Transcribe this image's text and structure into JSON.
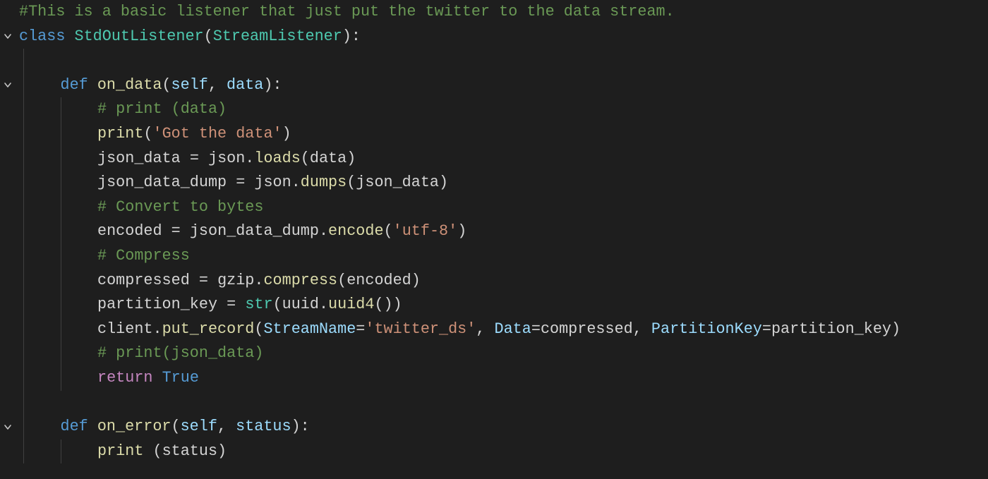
{
  "folds": [
    {
      "line": 2,
      "iconName": "chevron-down-icon"
    },
    {
      "line": 4,
      "iconName": "chevron-down-icon"
    },
    {
      "line": 18,
      "iconName": "chevron-down-icon"
    }
  ],
  "code": {
    "lines": [
      {
        "indent": 0,
        "tokens": [
          {
            "text": "#This is a basic listener that just put the twitter to the data stream.",
            "cls": "c-comment"
          }
        ]
      },
      {
        "indent": 0,
        "tokens": [
          {
            "text": "class",
            "cls": "c-keyword"
          },
          {
            "text": " ",
            "cls": "c-default"
          },
          {
            "text": "StdOutListener",
            "cls": "c-class"
          },
          {
            "text": "(",
            "cls": "c-default"
          },
          {
            "text": "StreamListener",
            "cls": "c-class"
          },
          {
            "text": "):",
            "cls": "c-default"
          }
        ]
      },
      {
        "indent": 1,
        "tokens": []
      },
      {
        "indent": 1,
        "tokens": [
          {
            "text": "def",
            "cls": "c-keyword"
          },
          {
            "text": " ",
            "cls": "c-default"
          },
          {
            "text": "on_data",
            "cls": "c-func"
          },
          {
            "text": "(",
            "cls": "c-default"
          },
          {
            "text": "self",
            "cls": "c-self"
          },
          {
            "text": ", ",
            "cls": "c-default"
          },
          {
            "text": "data",
            "cls": "c-param"
          },
          {
            "text": "):",
            "cls": "c-default"
          }
        ]
      },
      {
        "indent": 2,
        "tokens": [
          {
            "text": "# print (data)",
            "cls": "c-comment"
          }
        ]
      },
      {
        "indent": 2,
        "tokens": [
          {
            "text": "print",
            "cls": "c-func"
          },
          {
            "text": "(",
            "cls": "c-default"
          },
          {
            "text": "'Got the data'",
            "cls": "c-string"
          },
          {
            "text": ")",
            "cls": "c-default"
          }
        ]
      },
      {
        "indent": 2,
        "tokens": [
          {
            "text": "json_data ",
            "cls": "c-default"
          },
          {
            "text": "=",
            "cls": "c-assign"
          },
          {
            "text": " json.",
            "cls": "c-default"
          },
          {
            "text": "loads",
            "cls": "c-func"
          },
          {
            "text": "(data)",
            "cls": "c-default"
          }
        ]
      },
      {
        "indent": 2,
        "tokens": [
          {
            "text": "json_data_dump ",
            "cls": "c-default"
          },
          {
            "text": "=",
            "cls": "c-assign"
          },
          {
            "text": " json.",
            "cls": "c-default"
          },
          {
            "text": "dumps",
            "cls": "c-func"
          },
          {
            "text": "(json_data)",
            "cls": "c-default"
          }
        ]
      },
      {
        "indent": 2,
        "tokens": [
          {
            "text": "# Convert to bytes",
            "cls": "c-comment"
          }
        ]
      },
      {
        "indent": 2,
        "tokens": [
          {
            "text": "encoded ",
            "cls": "c-default"
          },
          {
            "text": "=",
            "cls": "c-assign"
          },
          {
            "text": " json_data_dump.",
            "cls": "c-default"
          },
          {
            "text": "encode",
            "cls": "c-func"
          },
          {
            "text": "(",
            "cls": "c-default"
          },
          {
            "text": "'utf-8'",
            "cls": "c-string"
          },
          {
            "text": ")",
            "cls": "c-default"
          }
        ]
      },
      {
        "indent": 2,
        "tokens": [
          {
            "text": "# Compress",
            "cls": "c-comment"
          }
        ]
      },
      {
        "indent": 2,
        "tokens": [
          {
            "text": "compressed ",
            "cls": "c-default"
          },
          {
            "text": "=",
            "cls": "c-assign"
          },
          {
            "text": " gzip.",
            "cls": "c-default"
          },
          {
            "text": "compress",
            "cls": "c-func"
          },
          {
            "text": "(encoded)",
            "cls": "c-default"
          }
        ]
      },
      {
        "indent": 2,
        "tokens": [
          {
            "text": "partition_key ",
            "cls": "c-default"
          },
          {
            "text": "=",
            "cls": "c-assign"
          },
          {
            "text": " ",
            "cls": "c-default"
          },
          {
            "text": "str",
            "cls": "c-class"
          },
          {
            "text": "(uuid.",
            "cls": "c-default"
          },
          {
            "text": "uuid4",
            "cls": "c-func"
          },
          {
            "text": "())",
            "cls": "c-default"
          }
        ]
      },
      {
        "indent": 2,
        "tokens": [
          {
            "text": "client.",
            "cls": "c-default"
          },
          {
            "text": "put_record",
            "cls": "c-func"
          },
          {
            "text": "(",
            "cls": "c-default"
          },
          {
            "text": "StreamName",
            "cls": "c-param"
          },
          {
            "text": "=",
            "cls": "c-assign"
          },
          {
            "text": "'twitter_ds'",
            "cls": "c-string"
          },
          {
            "text": ", ",
            "cls": "c-default"
          },
          {
            "text": "Data",
            "cls": "c-param"
          },
          {
            "text": "=",
            "cls": "c-assign"
          },
          {
            "text": "compressed, ",
            "cls": "c-default"
          },
          {
            "text": "PartitionKey",
            "cls": "c-param"
          },
          {
            "text": "=",
            "cls": "c-assign"
          },
          {
            "text": "partition_key)",
            "cls": "c-default"
          }
        ]
      },
      {
        "indent": 2,
        "tokens": [
          {
            "text": "# print(json_data)",
            "cls": "c-comment"
          }
        ]
      },
      {
        "indent": 2,
        "tokens": [
          {
            "text": "return",
            "cls": "c-keyword2"
          },
          {
            "text": " ",
            "cls": "c-default"
          },
          {
            "text": "True",
            "cls": "c-keyword"
          }
        ]
      },
      {
        "indent": 1,
        "tokens": []
      },
      {
        "indent": 1,
        "tokens": [
          {
            "text": "def",
            "cls": "c-keyword"
          },
          {
            "text": " ",
            "cls": "c-default"
          },
          {
            "text": "on_error",
            "cls": "c-func"
          },
          {
            "text": "(",
            "cls": "c-default"
          },
          {
            "text": "self",
            "cls": "c-self"
          },
          {
            "text": ", ",
            "cls": "c-default"
          },
          {
            "text": "status",
            "cls": "c-param"
          },
          {
            "text": "):",
            "cls": "c-default"
          }
        ]
      },
      {
        "indent": 2,
        "tokens": [
          {
            "text": "print",
            "cls": "c-func"
          },
          {
            "text": " (status)",
            "cls": "c-default"
          }
        ]
      }
    ]
  },
  "layout": {
    "lineHeight": 34.6,
    "indentUnitPx": 52.5
  }
}
